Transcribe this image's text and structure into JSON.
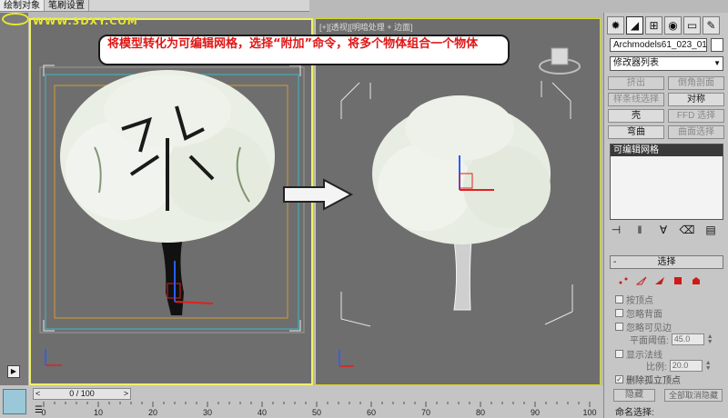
{
  "tabs": [
    "绘制对象",
    "笔刷设置"
  ],
  "watermark_url": "WWW.3DXY.COM",
  "callout_text": "将模型转化为可编辑网格，选择“附加”命令，将多个物体组合一个物体",
  "right_viewport_label": "[+][透视][明暗处理 + 边面]",
  "panel": {
    "object_name": "Archmodels61_023_01",
    "modifier_list": "修改器列表",
    "buttons": [
      {
        "label": "挤出",
        "enabled": false
      },
      {
        "label": "倒角剖面",
        "enabled": false
      },
      {
        "label": "样条线选择",
        "enabled": false
      },
      {
        "label": "对称",
        "enabled": true
      },
      {
        "label": "壳",
        "enabled": true
      },
      {
        "label": "FFD 选择",
        "enabled": false
      },
      {
        "label": "弯曲",
        "enabled": true
      },
      {
        "label": "曲面选择",
        "enabled": false
      }
    ],
    "stack_item": "可编辑网格",
    "rollout_title": "选择",
    "checkboxes": [
      {
        "label": "按顶点",
        "checked": false
      },
      {
        "label": "忽略背面",
        "checked": false
      },
      {
        "label": "忽略可见边",
        "checked": false
      },
      {
        "label": "显示法线",
        "checked": false
      },
      {
        "label": "删除孤立顶点",
        "checked": true
      }
    ],
    "plane_threshold_label": "平面阈值:",
    "plane_threshold_value": "45.0",
    "scale_label": "比例:",
    "scale_value": "20.0",
    "hide_label": "隐藏",
    "unhide_all_label": "全部取消隐藏",
    "named_selection_label": "命名选择:"
  },
  "timeline": {
    "frame_display": "0 / 100",
    "tick_labels": [
      "0",
      "10",
      "20",
      "30",
      "40",
      "50",
      "60",
      "70",
      "80",
      "90",
      "100"
    ]
  },
  "colors": {
    "viewport_bg": "#6e6e6e",
    "active_border": "#f0f06a",
    "callout_text": "#e01515"
  }
}
